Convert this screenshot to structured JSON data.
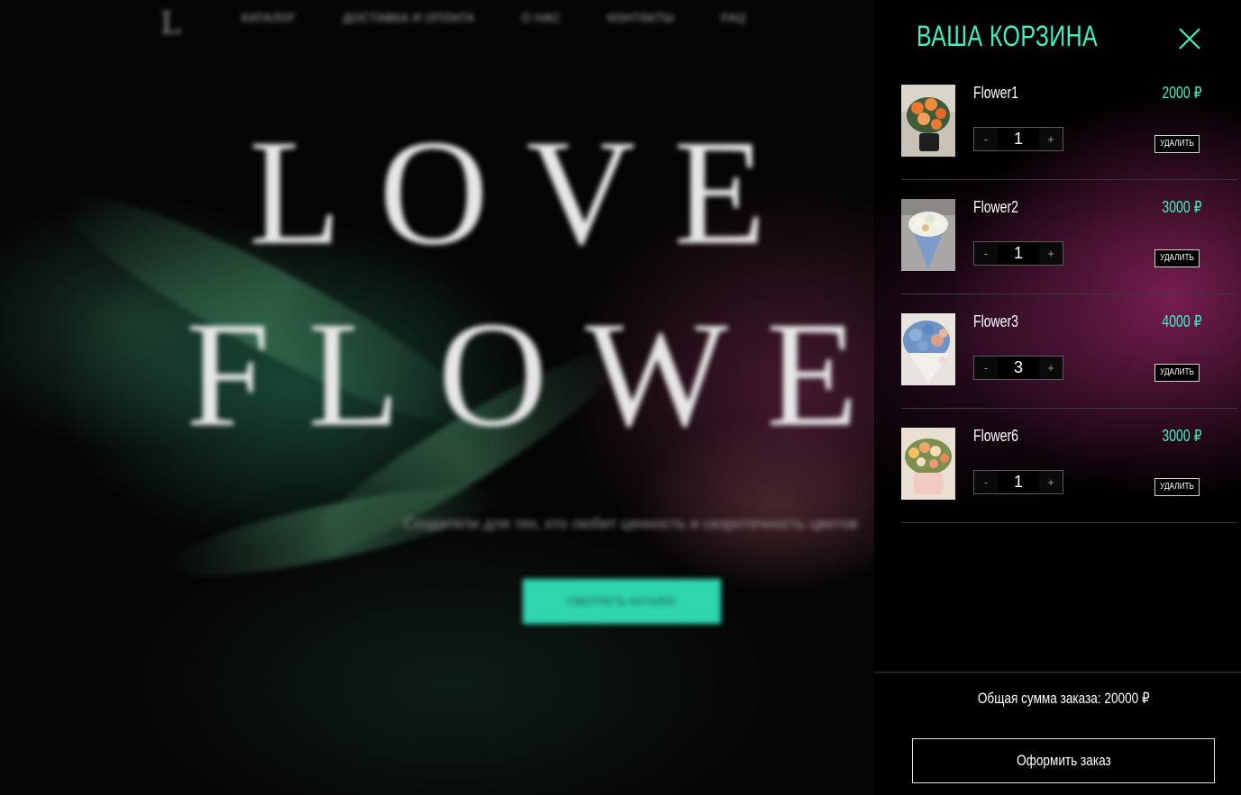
{
  "background": {
    "logo": "L",
    "nav": [
      "каталог",
      "доставка и оплата",
      "о нас",
      "контакты",
      "faq"
    ],
    "hero_line_1": "LOVE",
    "hero_line_2": "FLOWE",
    "subtitle": "Создатели для тех, кто любит ценность и скоротечность цветов",
    "cta": "смотреть каталог"
  },
  "cart": {
    "title": "ВАША КОРЗИНА",
    "close_icon": "close-icon",
    "accent_color": "#3ff0c2",
    "items": [
      {
        "name": "Flower1",
        "price": "2000 ₽",
        "quantity": "1",
        "minus": "-",
        "plus": "+",
        "remove": "УДАЛИТЬ"
      },
      {
        "name": "Flower2",
        "price": "3000 ₽",
        "quantity": "1",
        "minus": "-",
        "plus": "+",
        "remove": "УДАЛИТЬ"
      },
      {
        "name": "Flower3",
        "price": "4000 ₽",
        "quantity": "3",
        "minus": "-",
        "plus": "+",
        "remove": "УДАЛИТЬ"
      },
      {
        "name": "Flower6",
        "price": "3000 ₽",
        "quantity": "1",
        "minus": "-",
        "plus": "+",
        "remove": "УДАЛИТЬ"
      }
    ],
    "total": "Общая сумма заказа: 20000 ₽",
    "checkout": "Оформить заказ"
  }
}
